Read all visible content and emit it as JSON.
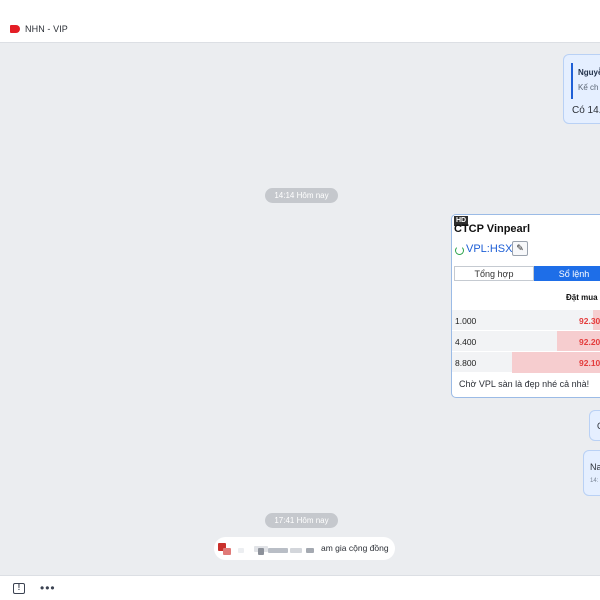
{
  "header": {
    "title": "NHN - VIP",
    "tag_color": "#e41e26"
  },
  "reply_bubble": {
    "quote_author": "Nguyễ",
    "quote_text": "Kế ch",
    "text": "Có 14.x"
  },
  "timestamps": [
    "14:14 Hôm nay",
    "17:41 Hôm nay"
  ],
  "stock_card": {
    "badge": "HD",
    "title": "CTCP Vinpearl",
    "ticker": "VPL:HSX",
    "tabs": [
      "Tổng hợp",
      "Sổ lệnh"
    ],
    "column_header": "Đặt mua",
    "rows": [
      {
        "qty": "1.000",
        "price": "92.30",
        "depth": 0.06
      },
      {
        "qty": "4.400",
        "price": "92.20",
        "depth": 0.3
      },
      {
        "qty": "8.800",
        "price": "92.10",
        "depth": 0.6
      }
    ],
    "caption": "Chờ VPL sàn là đẹp nhé cả nhà!",
    "accent": "#1e6ee8",
    "price_color": "#e43d3d"
  },
  "side_bubbles": {
    "peek_1": "C",
    "peek_2": "Na",
    "peek_2_time": "14:"
  },
  "incoming": {
    "text": "am gia cộng đồng"
  },
  "footer": {
    "icons": [
      "message-icon",
      "more-icon"
    ]
  }
}
